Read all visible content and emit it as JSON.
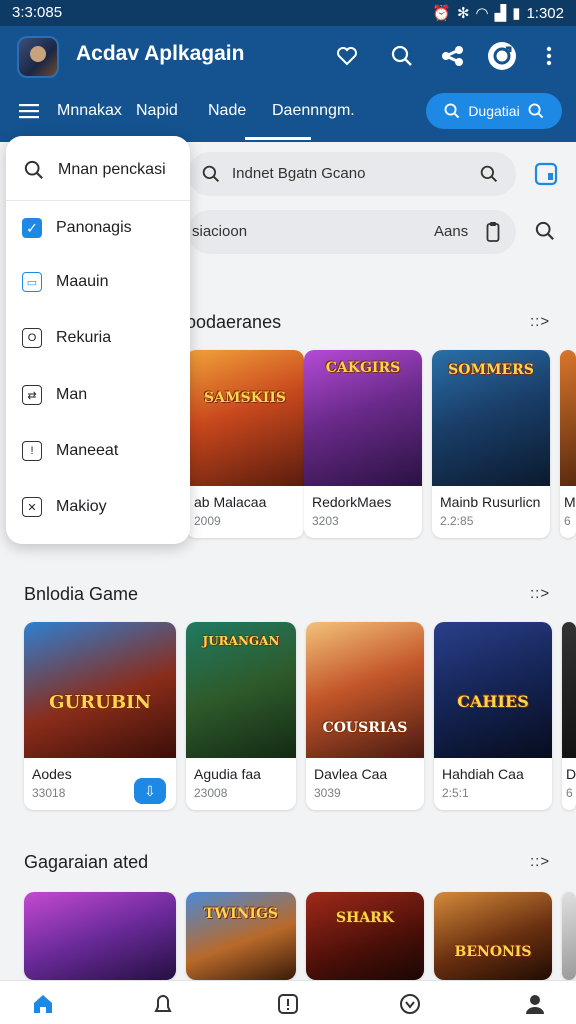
{
  "status_bar": {
    "time": "3:3:085",
    "clock": "1:302"
  },
  "app": {
    "title": "Acdav Aplkagain"
  },
  "tabs": [
    {
      "label": "Mnnakax"
    },
    {
      "label": "Napid"
    },
    {
      "label": "Nade"
    },
    {
      "label": "Daennngm."
    }
  ],
  "search_pill": {
    "label": "Dugatiai"
  },
  "search": {
    "value": "Indnet Bgatn Gcano"
  },
  "filter": {
    "left": "siacioon",
    "right": "Aans"
  },
  "dropdown": {
    "search_label": "Mnan penckasi",
    "items": [
      {
        "label": "Panonagis",
        "icon": "checkbox-checked-icon"
      },
      {
        "label": "Maauin",
        "icon": "window-icon"
      },
      {
        "label": "Rekuria",
        "icon": "square-icon"
      },
      {
        "label": "Man",
        "icon": "shuffle-icon"
      },
      {
        "label": "Maneeat",
        "icon": "info-icon"
      },
      {
        "label": "Makioy",
        "icon": "close-square-icon"
      }
    ]
  },
  "sections": [
    {
      "title": "oodaeranes",
      "more": "::>",
      "cards": [
        {
          "name": "ab Malacaa",
          "sub": "2009",
          "logo": "SAMSKIIS"
        },
        {
          "name": "RedorkMaes",
          "sub": "3203",
          "logo": "CAKGIRS"
        },
        {
          "name": "Mainb Rusurlicn",
          "sub": "2.2:85",
          "logo": "SOMMERS"
        },
        {
          "name": "M",
          "sub": "6",
          "logo": ""
        }
      ]
    },
    {
      "title": "Bnlodia Game",
      "more": "::>",
      "cards": [
        {
          "name": "Aodes",
          "sub": "33018",
          "logo": "GURUBIN"
        },
        {
          "name": "Agudia faa",
          "sub": "23008",
          "logo": "JURANGAN"
        },
        {
          "name": "Davlea Caa",
          "sub": "3039",
          "logo": "COUSRIAS"
        },
        {
          "name": "Hahdiah Caa",
          "sub": "2:5:1",
          "logo": "CAHIES"
        },
        {
          "name": "D",
          "sub": "6",
          "logo": ""
        }
      ]
    },
    {
      "title": "Gagaraian ated",
      "more": "::>",
      "cards": [
        {
          "name": "",
          "sub": "",
          "logo": ""
        },
        {
          "name": "",
          "sub": "",
          "logo": "TWINIGS"
        },
        {
          "name": "",
          "sub": "",
          "logo": "SHARK"
        },
        {
          "name": "",
          "sub": "",
          "logo": "BENONIS"
        },
        {
          "name": "",
          "sub": "",
          "logo": ""
        }
      ]
    }
  ],
  "colors": {
    "appbar": "#14538f",
    "accent": "#1e88e5"
  }
}
